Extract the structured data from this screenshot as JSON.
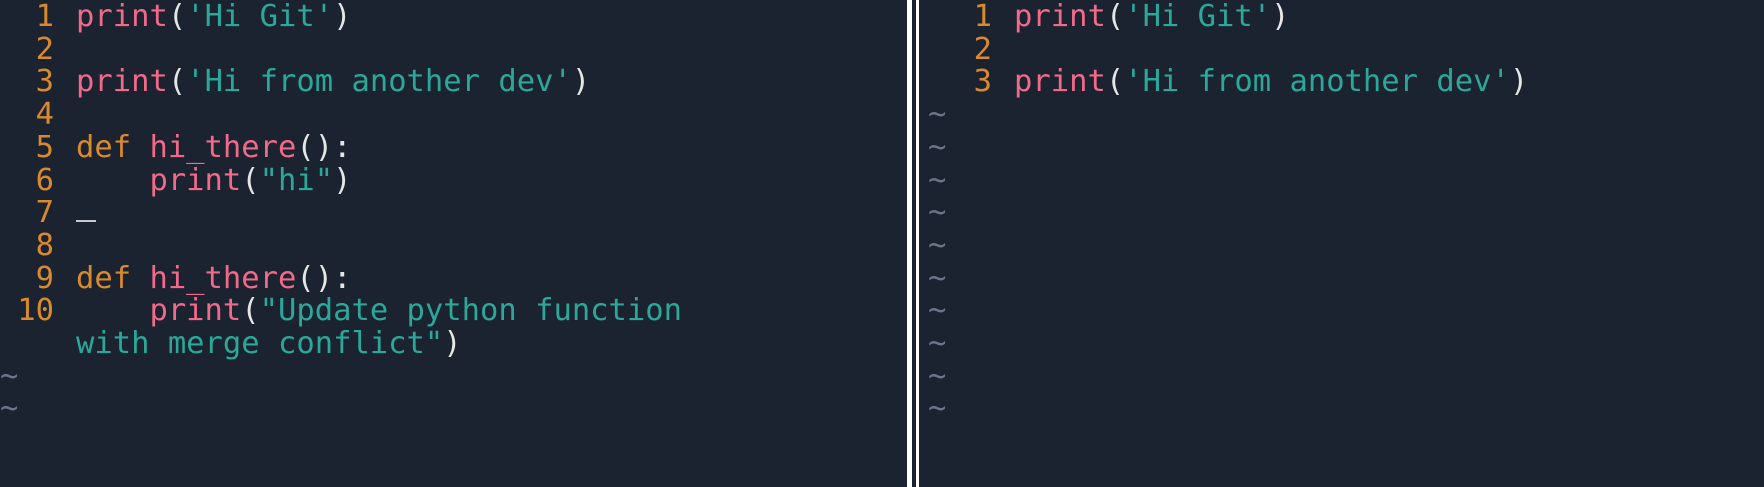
{
  "left_pane": {
    "lines": [
      {
        "num": "1",
        "parts": [
          [
            "fn",
            "print"
          ],
          [
            "pn",
            "("
          ],
          [
            "str",
            "'Hi Git'"
          ],
          [
            "pn",
            ")"
          ]
        ]
      },
      {
        "num": "2",
        "parts": []
      },
      {
        "num": "3",
        "parts": [
          [
            "fn",
            "print"
          ],
          [
            "pn",
            "("
          ],
          [
            "str",
            "'Hi from another dev'"
          ],
          [
            "pn",
            ")"
          ]
        ]
      },
      {
        "num": "4",
        "parts": []
      },
      {
        "num": "5",
        "parts": [
          [
            "kw",
            "def "
          ],
          [
            "fn",
            "hi_there"
          ],
          [
            "pn",
            "():"
          ]
        ]
      },
      {
        "num": "6",
        "parts": [
          [
            "pn",
            "    "
          ],
          [
            "fn",
            "print"
          ],
          [
            "pn",
            "("
          ],
          [
            "str",
            "\"hi\""
          ],
          [
            "pn",
            ")"
          ]
        ]
      },
      {
        "num": "7",
        "parts": [],
        "cursor": true
      },
      {
        "num": "8",
        "parts": []
      },
      {
        "num": "9",
        "parts": [
          [
            "kw",
            "def "
          ],
          [
            "fn",
            "hi_there"
          ],
          [
            "pn",
            "():"
          ]
        ]
      },
      {
        "num": "10",
        "parts": [
          [
            "pn",
            "    "
          ],
          [
            "fn",
            "print"
          ],
          [
            "pn",
            "("
          ],
          [
            "str",
            "\"Update python function"
          ]
        ]
      },
      {
        "num": "",
        "parts": [
          [
            "str",
            "with merge conflict\""
          ],
          [
            "pn",
            ")"
          ]
        ]
      }
    ],
    "empty_marker": "~",
    "empty_count": 2
  },
  "right_pane": {
    "lines": [
      {
        "num": "1",
        "parts": [
          [
            "fn",
            "print"
          ],
          [
            "pn",
            "("
          ],
          [
            "str",
            "'Hi Git'"
          ],
          [
            "pn",
            ")"
          ]
        ]
      },
      {
        "num": "2",
        "parts": []
      },
      {
        "num": "3",
        "parts": [
          [
            "fn",
            "print"
          ],
          [
            "pn",
            "("
          ],
          [
            "str",
            "'Hi from another dev'"
          ],
          [
            "pn",
            ")"
          ]
        ]
      }
    ],
    "empty_marker": "~",
    "empty_count": 10
  }
}
